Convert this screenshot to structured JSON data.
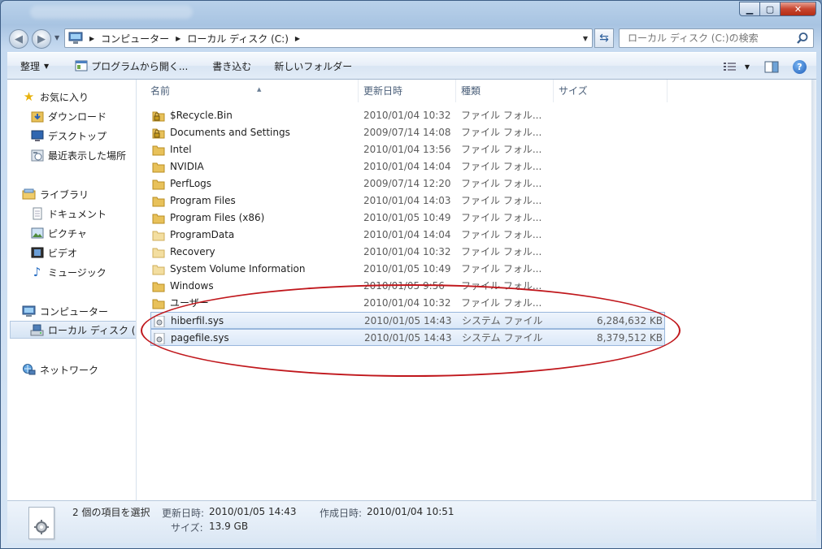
{
  "window": {
    "controls": {
      "minimize": "▁",
      "maximize": "▢",
      "close": "✕"
    }
  },
  "address_bar": {
    "crumbs": [
      "コンピューター",
      "ローカル ディスク (C:)"
    ]
  },
  "search": {
    "placeholder": "ローカル ディスク (C:)の検索"
  },
  "toolbar": {
    "organize": "整理",
    "open_with": "プログラムから開く...",
    "burn": "書き込む",
    "new_folder": "新しいフォルダー"
  },
  "sidebar": {
    "favorites": "お気に入り",
    "downloads": "ダウンロード",
    "desktop": "デスクトップ",
    "recent": "最近表示した場所",
    "libraries": "ライブラリ",
    "documents": "ドキュメント",
    "pictures": "ピクチャ",
    "videos": "ビデオ",
    "music": "ミュージック",
    "computer": "コンピューター",
    "local_disk": "ローカル ディスク (C:)",
    "network": "ネットワーク"
  },
  "columns": {
    "name": "名前",
    "date": "更新日時",
    "type": "種類",
    "size": "サイズ"
  },
  "files": [
    {
      "name": "$Recycle.Bin",
      "date": "2010/01/04 10:32",
      "type": "ファイル フォル...",
      "size": "",
      "icon": "locked-folder",
      "selected": false
    },
    {
      "name": "Documents and Settings",
      "date": "2009/07/14 14:08",
      "type": "ファイル フォル...",
      "size": "",
      "icon": "locked-folder",
      "selected": false
    },
    {
      "name": "Intel",
      "date": "2010/01/04 13:56",
      "type": "ファイル フォル...",
      "size": "",
      "icon": "folder",
      "selected": false
    },
    {
      "name": "NVIDIA",
      "date": "2010/01/04 14:04",
      "type": "ファイル フォル...",
      "size": "",
      "icon": "folder",
      "selected": false
    },
    {
      "name": "PerfLogs",
      "date": "2009/07/14 12:20",
      "type": "ファイル フォル...",
      "size": "",
      "icon": "folder",
      "selected": false
    },
    {
      "name": "Program Files",
      "date": "2010/01/04 14:03",
      "type": "ファイル フォル...",
      "size": "",
      "icon": "folder",
      "selected": false
    },
    {
      "name": "Program Files (x86)",
      "date": "2010/01/05 10:49",
      "type": "ファイル フォル...",
      "size": "",
      "icon": "folder",
      "selected": false
    },
    {
      "name": "ProgramData",
      "date": "2010/01/04 14:04",
      "type": "ファイル フォル...",
      "size": "",
      "icon": "folder-pale",
      "selected": false
    },
    {
      "name": "Recovery",
      "date": "2010/01/04 10:32",
      "type": "ファイル フォル...",
      "size": "",
      "icon": "folder-pale",
      "selected": false
    },
    {
      "name": "System Volume Information",
      "date": "2010/01/05 10:49",
      "type": "ファイル フォル...",
      "size": "",
      "icon": "folder-pale",
      "selected": false
    },
    {
      "name": "Windows",
      "date": "2010/01/05 9:56",
      "type": "ファイル フォル...",
      "size": "",
      "icon": "folder",
      "selected": false
    },
    {
      "name": "ユーザー",
      "date": "2010/01/04 10:32",
      "type": "ファイル フォル...",
      "size": "",
      "icon": "folder",
      "selected": false
    },
    {
      "name": "hiberfil.sys",
      "date": "2010/01/05 14:43",
      "type": "システム ファイル",
      "size": "6,284,632 KB",
      "icon": "system-file",
      "selected": true
    },
    {
      "name": "pagefile.sys",
      "date": "2010/01/05 14:43",
      "type": "システム ファイル",
      "size": "8,379,512 KB",
      "icon": "system-file",
      "selected": true
    }
  ],
  "details": {
    "count": "2 個の項目を選択",
    "modified_label": "更新日時:",
    "modified_value": "2010/01/05 14:43",
    "created_label": "作成日時:",
    "created_value": "2010/01/04 10:51",
    "size_label": "サイズ:",
    "size_value": "13.9 GB"
  },
  "colors": {
    "selection_border": "#99b7dc",
    "annotation": "#c0171c",
    "folder": "#e8c15a"
  }
}
